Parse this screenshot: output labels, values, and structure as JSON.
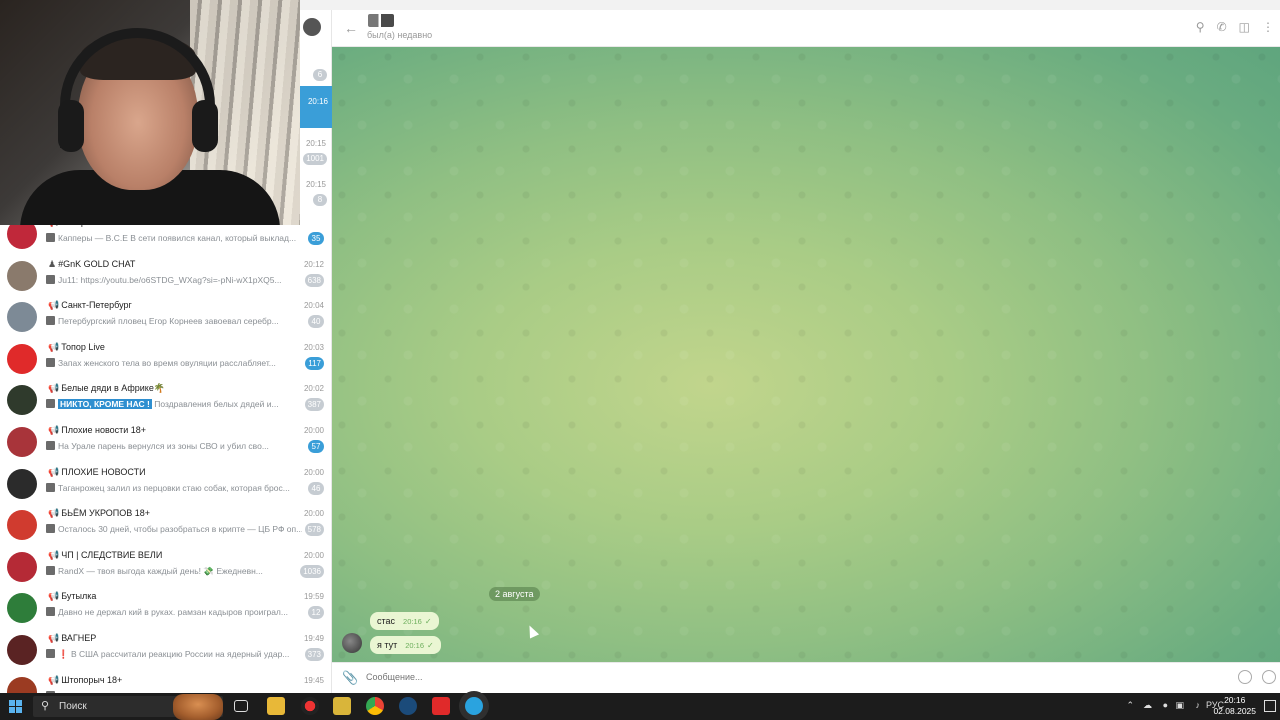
{
  "header": {
    "status": "был(а) недавно"
  },
  "side_column": {
    "times": [
      "20:16",
      "20:15",
      "20:15"
    ],
    "badges": [
      "6",
      "1001",
      "8"
    ]
  },
  "chats": [
    {
      "name": "Топор+",
      "time": "20:12",
      "preview": "Капперы — В.С.Е В сети появился канал, который выклад...",
      "count": "35",
      "count_color": "blue",
      "avatar_color": "#c0283a",
      "channel": true
    },
    {
      "name": "#GnK GOLD CHAT",
      "time": "20:12",
      "preview": "Ju11: https://youtu.be/o6STDG_WXag?si=-pNi-wX1pXQ5...",
      "count": "638",
      "count_color": "gray",
      "avatar_color": "#8a7a6c",
      "channel": false,
      "group": true
    },
    {
      "name": "Санкт-Петербург",
      "time": "20:04",
      "preview": "Петербургский пловец Егор Корнеев завоевал серебр...",
      "count": "40",
      "count_color": "gray",
      "avatar_color": "#7d8a96",
      "channel": true
    },
    {
      "name": "Топор Live",
      "time": "20:03",
      "preview": "Запах женского тела во время овуляции расслабляет...",
      "count": "117",
      "count_color": "blue",
      "avatar_color": "#e02a2a",
      "channel": true
    },
    {
      "name": "Белые дяди в Африке🌴",
      "time": "20:02",
      "preview_highlight": "НИКТО, КРОМЕ НАС !",
      "preview": "Поздравления белых дядей и...",
      "count": "387",
      "count_color": "gray",
      "avatar_color": "#2f3a2c",
      "channel": true
    },
    {
      "name": "Плохие новости 18+",
      "time": "20:00",
      "preview": "На Урале парень вернулся из зоны СВО и убил сво...",
      "count": "57",
      "count_color": "blue",
      "avatar_color": "#a8343a",
      "channel": true
    },
    {
      "name": "ПЛОХИЕ НОВОСТИ",
      "time": "20:00",
      "preview": "Таганрожец залил из перцовки стаю собак, которая брос...",
      "count": "46",
      "count_color": "gray",
      "avatar_color": "#2b2b2b",
      "channel": true
    },
    {
      "name": "БЬЁМ УКРОПОВ 18+",
      "time": "20:00",
      "preview": "Осталось 30 дней, чтобы разобраться в крипте — ЦБ РФ оп...",
      "count": "578",
      "count_color": "gray",
      "avatar_color": "#d03b2f",
      "channel": true
    },
    {
      "name": "ЧП | СЛЕДСТВИЕ ВЕЛИ",
      "time": "20:00",
      "preview": "RandX — твоя выгода каждый день! 💸 Ежедневн...",
      "count": "1036",
      "count_color": "gray",
      "avatar_color": "#b52a36",
      "channel": true
    },
    {
      "name": "Бутылка",
      "time": "19:59",
      "preview": "Давно не держал кий в руках. рамзан кадыров проиграл...",
      "count": "12",
      "count_color": "gray",
      "avatar_color": "#2e7d3a",
      "channel": true
    },
    {
      "name": "ВАГНЕР",
      "time": "19:49",
      "preview": "❗ В США рассчитали реакцию России на ядерный удар...",
      "count": "373",
      "count_color": "gray",
      "avatar_color": "#5a2323",
      "channel": true
    },
    {
      "name": "Штопорыч 18+",
      "time": "19:45",
      "preview": "",
      "count": "",
      "count_color": "gray",
      "avatar_color": "#9b3b22",
      "channel": true
    }
  ],
  "chat": {
    "date_pill": "2 августа",
    "messages": [
      {
        "text": "стас",
        "time": "20:16"
      },
      {
        "text": "я тут",
        "time": "20:16"
      }
    ]
  },
  "composer": {
    "placeholder": "Сообщение..."
  },
  "taskbar": {
    "search_label": "Поиск",
    "lang": "РУС",
    "time": "20:16",
    "date": "02.08.2025"
  },
  "icons": {
    "back": "arrow-left-icon",
    "search": "search-icon",
    "call": "phone-icon",
    "sidebar": "sidebar-toggle-icon",
    "attach": "paperclip-icon"
  }
}
